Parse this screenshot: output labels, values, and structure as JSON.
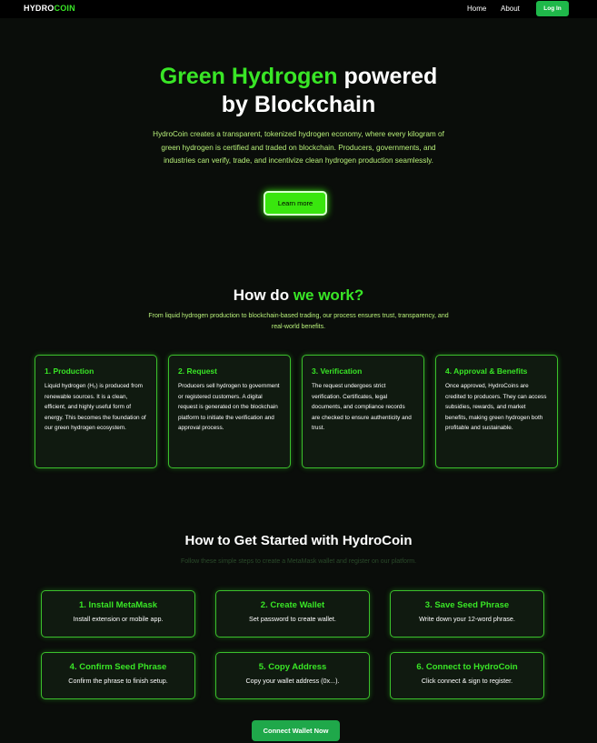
{
  "nav": {
    "logo_part1": "HYDRO",
    "logo_part2": "COIN",
    "home": "Home",
    "about": "About",
    "login": "Log In"
  },
  "hero": {
    "title_green": "Green Hydrogen",
    "title_white1": " powered",
    "title_white2": "by Blockchain",
    "description": "HydroCoin creates a transparent, tokenized hydrogen economy, where every kilogram of green hydrogen is certified and traded on blockchain. Producers, governments, and industries can verify, trade, and incentivize clean hydrogen production seamlessly.",
    "cta": "Learn more"
  },
  "how": {
    "title_white": "How do ",
    "title_green": "we work?",
    "subtitle": "From liquid hydrogen production to blockchain-based trading, our process ensures trust, transparency, and real-world benefits.",
    "cards": [
      {
        "title": "1. Production",
        "text": "Liquid hydrogen (H₂) is produced from renewable sources. It is a clean, efficient, and highly useful form of energy. This becomes the foundation of our green hydrogen ecosystem."
      },
      {
        "title": "2. Request",
        "text": "Producers sell hydrogen to government or registered customers. A digital request is generated on the blockchain platform to initiate the verification and approval process."
      },
      {
        "title": "3. Verification",
        "text": "The request undergoes strict verification. Certificates, legal documents, and compliance records are checked to ensure authenticity and trust."
      },
      {
        "title": "4. Approval & Benefits",
        "text": "Once approved, HydroCoins are credited to producers. They can access subsidies, rewards, and market benefits, making green hydrogen both profitable and sustainable."
      }
    ]
  },
  "start": {
    "title": "How to Get Started with HydroCoin",
    "subtitle": "Follow these simple steps to create a MetaMask wallet and register on our platform.",
    "steps": [
      {
        "title": "1. Install MetaMask",
        "desc": "Install extension or mobile app."
      },
      {
        "title": "2. Create Wallet",
        "desc": "Set password to create wallet."
      },
      {
        "title": "3. Save Seed Phrase",
        "desc": "Write down your 12-word phrase."
      },
      {
        "title": "4. Confirm Seed Phrase",
        "desc": "Confirm the phrase to finish setup."
      },
      {
        "title": "5. Copy Address",
        "desc": "Copy your wallet address (0x...)."
      },
      {
        "title": "6. Connect to HydroCoin",
        "desc": "Click connect & sign to register."
      }
    ],
    "cta": "Connect Wallet Now"
  },
  "colors": {
    "accent": "#39e626",
    "background": "#0a0d0a",
    "button": "#1fb84a"
  }
}
